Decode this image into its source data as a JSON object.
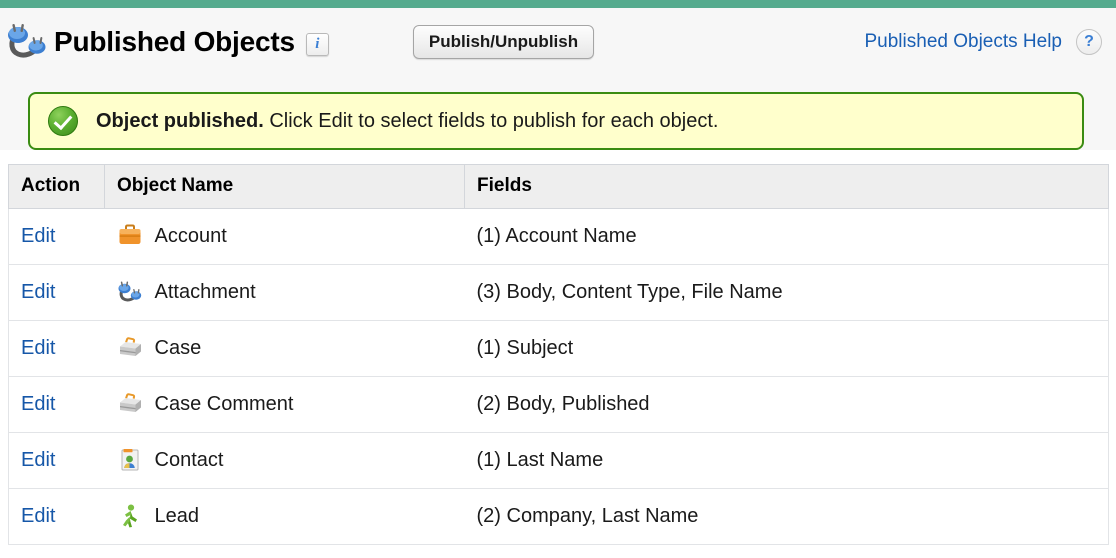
{
  "theme": {
    "accent_bar_color": "#55ab8e",
    "link_color": "#1657a8",
    "banner_bg": "#ffffcc",
    "banner_border": "#3a8c12"
  },
  "header": {
    "icon": "attachment-icon",
    "title": "Published Objects",
    "info_icon_label": "i",
    "publish_button_label": "Publish/Unpublish",
    "help_link_label": "Published Objects Help",
    "help_icon_label": "?"
  },
  "banner": {
    "icon": "success-check-icon",
    "strong_text": "Object published.",
    "rest_text": " Click Edit to select fields to publish for each object."
  },
  "table": {
    "columns": [
      "Action",
      "Object Name",
      "Fields"
    ],
    "rows": [
      {
        "action": "Edit",
        "icon": "briefcase-orange-icon",
        "name": "Account",
        "fields": "(1) Account Name"
      },
      {
        "action": "Edit",
        "icon": "attachment-icon",
        "name": "Attachment",
        "fields": "(3) Body, Content Type, File Name"
      },
      {
        "action": "Edit",
        "icon": "briefcase-gray-icon",
        "name": "Case",
        "fields": "(1) Subject"
      },
      {
        "action": "Edit",
        "icon": "briefcase-gray-icon",
        "name": "Case Comment",
        "fields": "(2) Body, Published"
      },
      {
        "action": "Edit",
        "icon": "contact-card-icon",
        "name": "Contact",
        "fields": "(1) Last Name"
      },
      {
        "action": "Edit",
        "icon": "lead-person-icon",
        "name": "Lead",
        "fields": "(2) Company, Last Name"
      }
    ]
  }
}
